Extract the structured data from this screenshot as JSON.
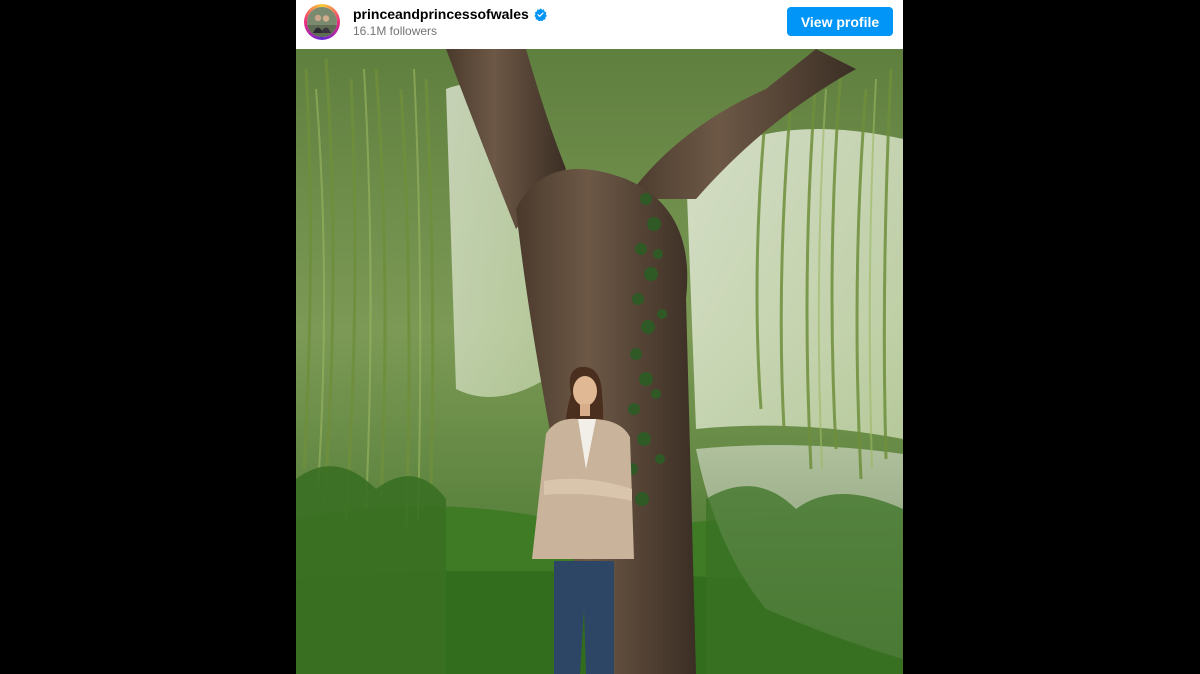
{
  "profile": {
    "username": "princeandprincessofwales",
    "followers": "16.1M followers",
    "verified": true,
    "view_profile_label": "View profile"
  },
  "post": {
    "image": "photo of a woman in a tan blazer and jeans leaning against a large willow tree beside a pond"
  },
  "colors": {
    "button": "#0095f6",
    "verified_badge": "#0095f6",
    "page_background": "#000000"
  },
  "icons": [
    "verified-badge-icon"
  ]
}
